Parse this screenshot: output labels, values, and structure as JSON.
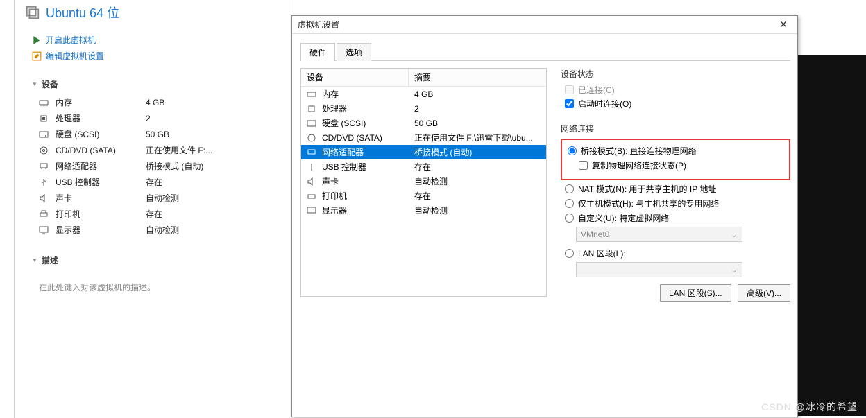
{
  "vm": {
    "name": "Ubuntu 64 位"
  },
  "actions": {
    "power_on": "开启此虚拟机",
    "edit": "编辑虚拟机设置"
  },
  "sections": {
    "devices": "设备",
    "description": "描述",
    "desc_placeholder": "在此处键入对该虚拟机的描述。"
  },
  "left_devices": {
    "memory": {
      "label": "内存",
      "value": "4 GB"
    },
    "cpu": {
      "label": "处理器",
      "value": "2"
    },
    "disk": {
      "label": "硬盘 (SCSI)",
      "value": "50 GB"
    },
    "cd": {
      "label": "CD/DVD (SATA)",
      "value": "正在使用文件 F:..."
    },
    "net": {
      "label": "网络适配器",
      "value": "桥接模式 (自动)"
    },
    "usb": {
      "label": "USB 控制器",
      "value": "存在"
    },
    "sound": {
      "label": "声卡",
      "value": "自动检测"
    },
    "printer": {
      "label": "打印机",
      "value": "存在"
    },
    "display": {
      "label": "显示器",
      "value": "自动检测"
    }
  },
  "dialog": {
    "title": "虚拟机设置",
    "tabs": {
      "hardware": "硬件",
      "options": "选项"
    },
    "cols": {
      "device": "设备",
      "summary": "摘要"
    },
    "rows": {
      "memory": {
        "label": "内存",
        "value": "4 GB"
      },
      "cpu": {
        "label": "处理器",
        "value": "2"
      },
      "disk": {
        "label": "硬盘 (SCSI)",
        "value": "50 GB"
      },
      "cd": {
        "label": "CD/DVD (SATA)",
        "value": "正在使用文件 F:\\迅雷下载\\ubu..."
      },
      "net": {
        "label": "网络适配器",
        "value": "桥接模式 (自动)"
      },
      "usb": {
        "label": "USB 控制器",
        "value": "存在"
      },
      "sound": {
        "label": "声卡",
        "value": "自动检测"
      },
      "printer": {
        "label": "打印机",
        "value": "存在"
      },
      "display": {
        "label": "显示器",
        "value": "自动检测"
      }
    },
    "device_state": {
      "title": "设备状态",
      "connected": "已连接(C)",
      "connect_on_start": "启动时连接(O)"
    },
    "network": {
      "title": "网络连接",
      "bridge": "桥接模式(B): 直接连接物理网络",
      "replicate": "复制物理网络连接状态(P)",
      "nat": "NAT 模式(N): 用于共享主机的 IP 地址",
      "hostonly": "仅主机模式(H): 与主机共享的专用网络",
      "custom": "自定义(U): 特定虚拟网络",
      "vmnet": "VMnet0",
      "lan": "LAN 区段(L):"
    },
    "buttons": {
      "lan_seg": "LAN 区段(S)...",
      "advanced": "高级(V)..."
    }
  },
  "watermark": "CSDN @冰冷的希望"
}
